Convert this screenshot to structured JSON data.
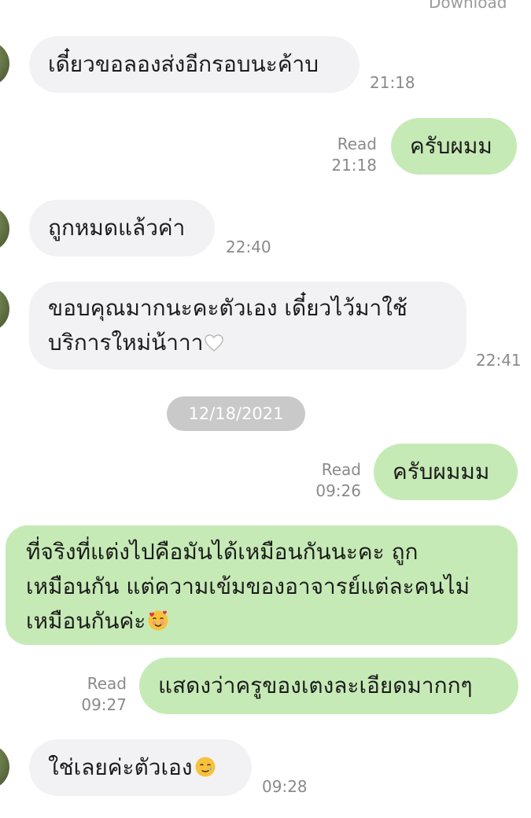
{
  "top": {
    "download_label": "Download"
  },
  "messages": [
    {
      "text": "เดี๋ยวขอลองส่งอีกรอบนะค้าบ",
      "time": "21:18"
    },
    {
      "text": "ครับผมม",
      "read": "Read",
      "time": "21:18"
    },
    {
      "text": "ถูกหมดแล้วค่า",
      "time": "22:40"
    },
    {
      "line1": "ขอบคุณมากนะคะตัวเอง เดี๋ยวไว้มาใช้",
      "line2": "บริการใหม่น้าาา",
      "time": "22:41",
      "emoji": "white-heart-icon"
    },
    {
      "text": "ครับผมมม",
      "read": "Read",
      "time": "09:26"
    },
    {
      "line1": "ที่จริงที่แต่งไปคือมันได้เหมือนกันนะคะ ถูก",
      "line2": "เหมือนกัน แต่ความเข้มของอาจารย์แต่ละคนไม่",
      "line3": "เหมือนกันค่ะ",
      "emoji": "smiling-face-with-hearts-icon"
    },
    {
      "text": "แสดงว่าครูของเตงละเอียดมากกๆ",
      "read": "Read",
      "time": "09:27"
    },
    {
      "text": "ใช่เลยค่ะตัวเอง",
      "time": "09:28",
      "emoji": "smiling-face-with-tear-icon"
    }
  ],
  "date_separator": "12/18/2021",
  "colors": {
    "incoming_bubble": "#f2f2f4",
    "outgoing_bubble": "#c6eab6",
    "meta_text": "#8a8a8a",
    "date_pill": "#c9c9c9"
  }
}
